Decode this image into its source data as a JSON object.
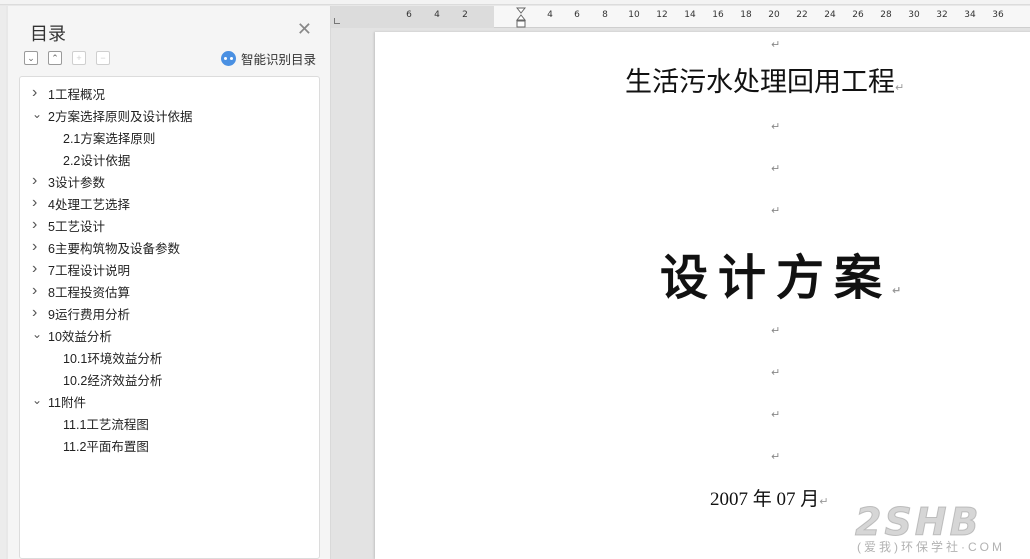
{
  "nav": {
    "title": "目录",
    "smart_toc_label": "智能识别目录",
    "tools": [
      "collapse-all",
      "expand-all",
      "add-heading",
      "remove-heading"
    ],
    "items": [
      {
        "label": "1工程概况",
        "level": 1,
        "state": "collapsed"
      },
      {
        "label": "2方案选择原则及设计依据",
        "level": 1,
        "state": "expanded"
      },
      {
        "label": "2.1方案选择原则",
        "level": 2,
        "state": "leaf"
      },
      {
        "label": "2.2设计依据",
        "level": 2,
        "state": "leaf"
      },
      {
        "label": "3设计参数",
        "level": 1,
        "state": "collapsed"
      },
      {
        "label": "4处理工艺选择",
        "level": 1,
        "state": "collapsed"
      },
      {
        "label": "5工艺设计",
        "level": 1,
        "state": "collapsed"
      },
      {
        "label": "6主要构筑物及设备参数",
        "level": 1,
        "state": "collapsed"
      },
      {
        "label": "7工程设计说明",
        "level": 1,
        "state": "collapsed"
      },
      {
        "label": "8工程投资估算",
        "level": 1,
        "state": "collapsed"
      },
      {
        "label": "9运行费用分析",
        "level": 1,
        "state": "collapsed"
      },
      {
        "label": "10效益分析",
        "level": 1,
        "state": "expanded"
      },
      {
        "label": "10.1环境效益分析",
        "level": 2,
        "state": "leaf"
      },
      {
        "label": "10.2经济效益分析",
        "level": 2,
        "state": "leaf"
      },
      {
        "label": "11附件",
        "level": 1,
        "state": "expanded"
      },
      {
        "label": "11.1工艺流程图",
        "level": 2,
        "state": "leaf"
      },
      {
        "label": "11.2平面布置图",
        "level": 2,
        "state": "leaf"
      }
    ]
  },
  "ruler": {
    "labels": [
      "6",
      "4",
      "2",
      "4",
      "6",
      "8",
      "10",
      "12",
      "14",
      "16",
      "18",
      "20",
      "22",
      "24",
      "26",
      "28",
      "30",
      "32",
      "34",
      "36"
    ]
  },
  "document": {
    "title": "生活污水处理回用工程",
    "subtitle": "设计方案",
    "date": "2007 年 07 月",
    "paragraph_mark": "↵"
  },
  "watermark": {
    "logo_text": "2SHB",
    "tagline": "(爱我)环保学社·COM"
  }
}
